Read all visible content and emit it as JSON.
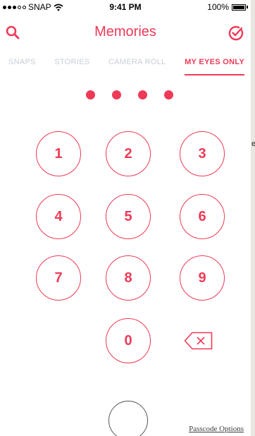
{
  "status_bar": {
    "carrier": "SNAP",
    "time": "9:41 PM",
    "battery": "100%",
    "signal_icon": "signal-dots-icon",
    "wifi_icon": "wifi-icon",
    "battery_icon": "battery-icon"
  },
  "header": {
    "title": "Memories",
    "left_icon": "search-icon",
    "right_icon": "select-check-icon"
  },
  "tabs": [
    {
      "label": "SNAPS",
      "active": false
    },
    {
      "label": "STORIES",
      "active": false
    },
    {
      "label": "CAMERA ROLL",
      "active": false
    },
    {
      "label": "MY EYES ONLY",
      "active": true
    }
  ],
  "passcode": {
    "entered_digits": 4
  },
  "keypad": {
    "keys": [
      "1",
      "2",
      "3",
      "4",
      "5",
      "6",
      "7",
      "8",
      "9",
      "0"
    ],
    "delete_icon": "backspace-icon"
  },
  "footer": {
    "passcode_options": "Passcode Options",
    "home_button_icon": "home-button"
  },
  "background_text": "e",
  "colors": {
    "accent": "#ee3a57",
    "tab_inactive": "#c9cdd6",
    "background": "#ffffff"
  }
}
